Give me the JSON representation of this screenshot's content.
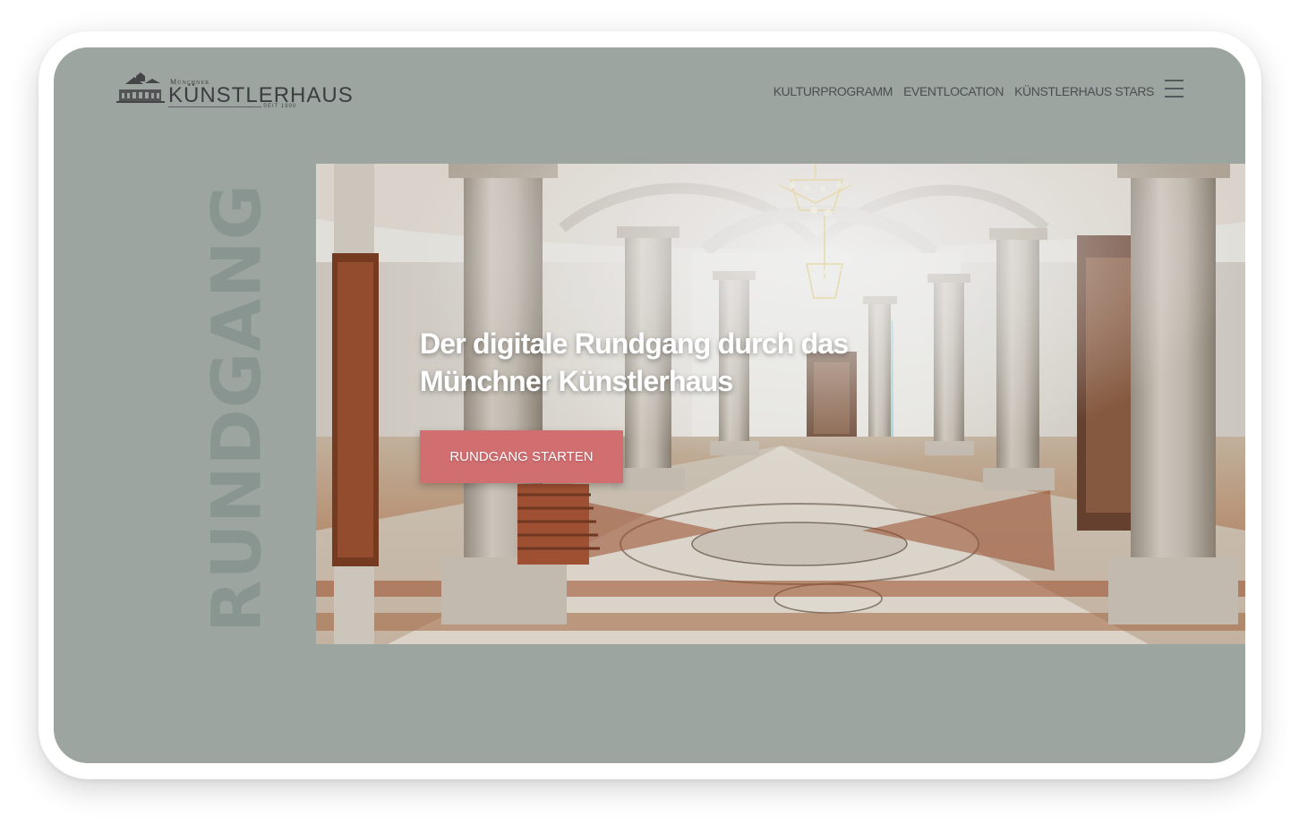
{
  "logo": {
    "overline": "Münchner",
    "main": "KÜNSTLERHAUS",
    "tagline": "SEIT 1900"
  },
  "navigation": {
    "items": [
      {
        "label": "KULTURPROGRAMM"
      },
      {
        "label": "EVENTLOCATION"
      },
      {
        "label": "KÜNSTLERHAUS STARS"
      }
    ]
  },
  "side_label": "RUNDGANG",
  "hero": {
    "title_line_1": "Der digitale Rundgang durch das",
    "title_line_2": "Münchner Künstlerhaus",
    "cta_label": "RUNDGANG STARTEN"
  },
  "colors": {
    "screen_background": "#9da5a0",
    "button": "#d06e70",
    "navigation_text": "#4b4d51",
    "side_label": "#899591"
  },
  "icons": {
    "menu": "hamburger-menu-icon",
    "building": "building-logo-icon"
  }
}
